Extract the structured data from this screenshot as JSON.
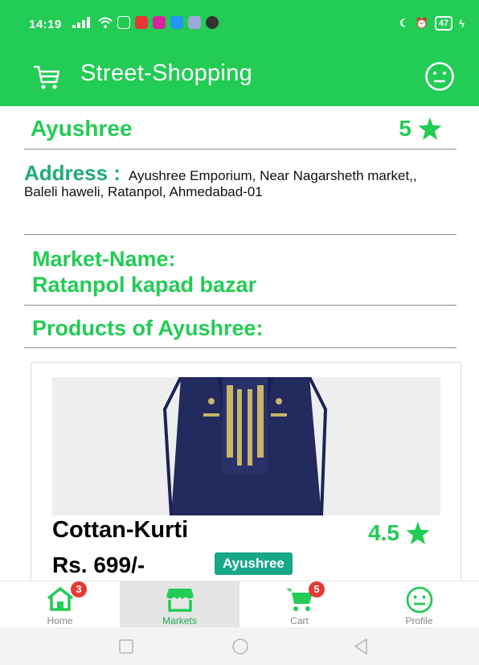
{
  "status_bar": {
    "time": "14:19",
    "battery": "47"
  },
  "app_bar": {
    "title": "Street-Shopping",
    "cart_icon": "cart-icon",
    "profile_icon": "smiley-icon"
  },
  "shop": {
    "name": "Ayushree",
    "rating": "5",
    "address_label": "Address :",
    "address_text": "Ayushree Emporium, Near Nagarsheth market,, Baleli haweli, Ratanpol, Ahmedabad-01",
    "market_label": "Market-Name:",
    "market_name": "Ratanpol kapad bazar",
    "products_heading": "Products of Ayushree:"
  },
  "products": [
    {
      "name": "Cottan-Kurti",
      "rating": "4.5",
      "price": "Rs. 699/-",
      "shop_badge": "Ayushree"
    }
  ],
  "bottom_nav": {
    "items": [
      {
        "label": "Home",
        "icon": "home-icon",
        "badge": "3"
      },
      {
        "label": "Markets",
        "icon": "store-icon"
      },
      {
        "label": "Cart",
        "icon": "cart-icon",
        "badge": "5"
      },
      {
        "label": "Profile",
        "icon": "smiley-icon"
      }
    ]
  },
  "colors": {
    "primary": "#22cc55",
    "teal": "#18a889",
    "badge_red": "#e53935"
  }
}
